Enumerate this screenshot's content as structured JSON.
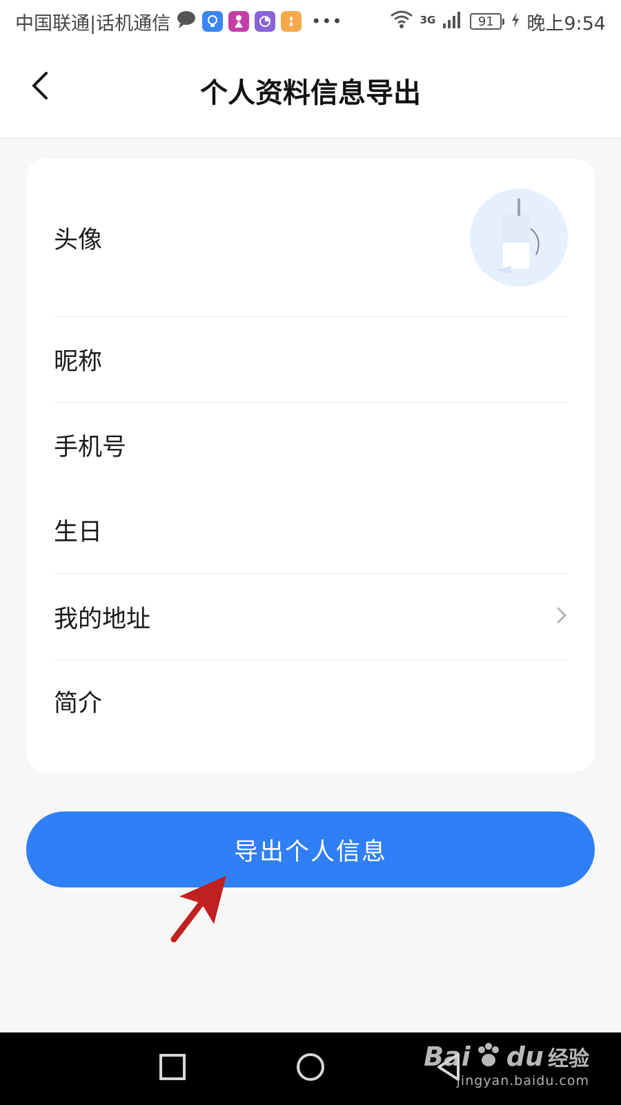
{
  "status_bar": {
    "carrier": "中国联通|话机通信",
    "network": "3G",
    "battery": "91",
    "time": "晚上9:54",
    "icons": [
      "message-icon",
      "bulb-app-icon",
      "game-app-icon",
      "chart-app-icon",
      "orange-app-icon",
      "more-icon",
      "wifi-icon",
      "signal-icon",
      "charging-icon"
    ]
  },
  "header": {
    "title": "个人资料信息导出",
    "back_icon": "chevron-left-icon"
  },
  "profile_rows": [
    {
      "label": "头像"
    },
    {
      "label": "昵称"
    },
    {
      "label": "手机号"
    },
    {
      "label": "生日"
    },
    {
      "label": "我的地址"
    },
    {
      "label": "简介"
    }
  ],
  "export_button": {
    "label": "导出个人信息",
    "color": "#2f7ff6"
  },
  "annotation": {
    "arrow_color": "#c0201f"
  },
  "nav_bar": {
    "buttons": [
      "recent-apps-icon",
      "home-icon",
      "back-triangle-icon"
    ]
  },
  "watermark": {
    "brand_bai": "Bai",
    "brand_du": "du",
    "brand_suffix": "经验",
    "url": "jingyan.baidu.com"
  }
}
